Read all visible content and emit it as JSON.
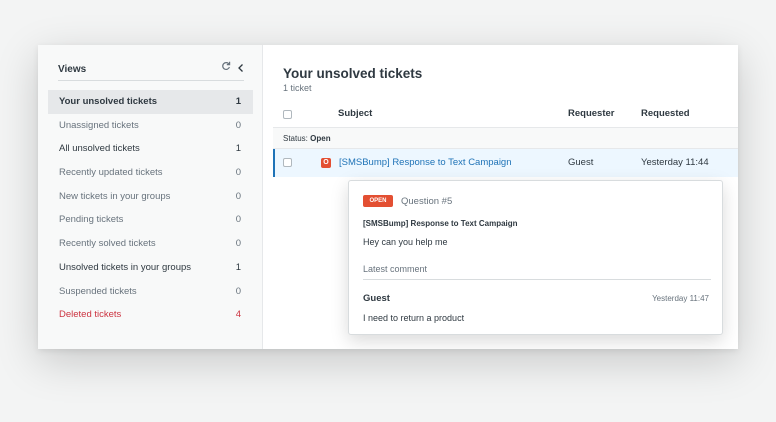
{
  "sidebar": {
    "title": "Views",
    "refresh_icon": "refresh-icon",
    "collapse_icon": "chevron-left-icon",
    "items": [
      {
        "label": "Your unsolved tickets",
        "count": "1",
        "state": "active"
      },
      {
        "label": "Unassigned tickets",
        "count": "0",
        "state": "normal"
      },
      {
        "label": "All unsolved tickets",
        "count": "1",
        "state": "bold"
      },
      {
        "label": "Recently updated tickets",
        "count": "0",
        "state": "normal"
      },
      {
        "label": "New tickets in your groups",
        "count": "0",
        "state": "normal"
      },
      {
        "label": "Pending tickets",
        "count": "0",
        "state": "normal"
      },
      {
        "label": "Recently solved tickets",
        "count": "0",
        "state": "normal"
      },
      {
        "label": "Unsolved tickets in your groups",
        "count": "1",
        "state": "bold"
      },
      {
        "label": "Suspended tickets",
        "count": "0",
        "state": "normal"
      },
      {
        "label": "Deleted tickets",
        "count": "4",
        "state": "deleted"
      }
    ]
  },
  "main": {
    "title": "Your unsolved tickets",
    "ticket_count": "1 ticket",
    "columns": {
      "subject": "Subject",
      "requester": "Requester",
      "requested": "Requested"
    },
    "group": {
      "label": "Status:",
      "value": "Open"
    },
    "tickets": [
      {
        "status_letter": "O",
        "subject": "[SMSBump] Response to Text Campaign",
        "requester": "Guest",
        "requested": "Yesterday 11:44"
      }
    ]
  },
  "hovercard": {
    "status_badge": "OPEN",
    "question": "Question #5",
    "subject": "[SMSBump] Response to Text Campaign",
    "description": "Hey can you help me",
    "latest_label": "Latest comment",
    "comment_author": "Guest",
    "comment_time": "Yesterday 11:47",
    "comment_body": "I need to return a product"
  },
  "colors": {
    "accent": "#1f73b7",
    "open_status": "#e34f32",
    "deleted": "#cc3340"
  }
}
